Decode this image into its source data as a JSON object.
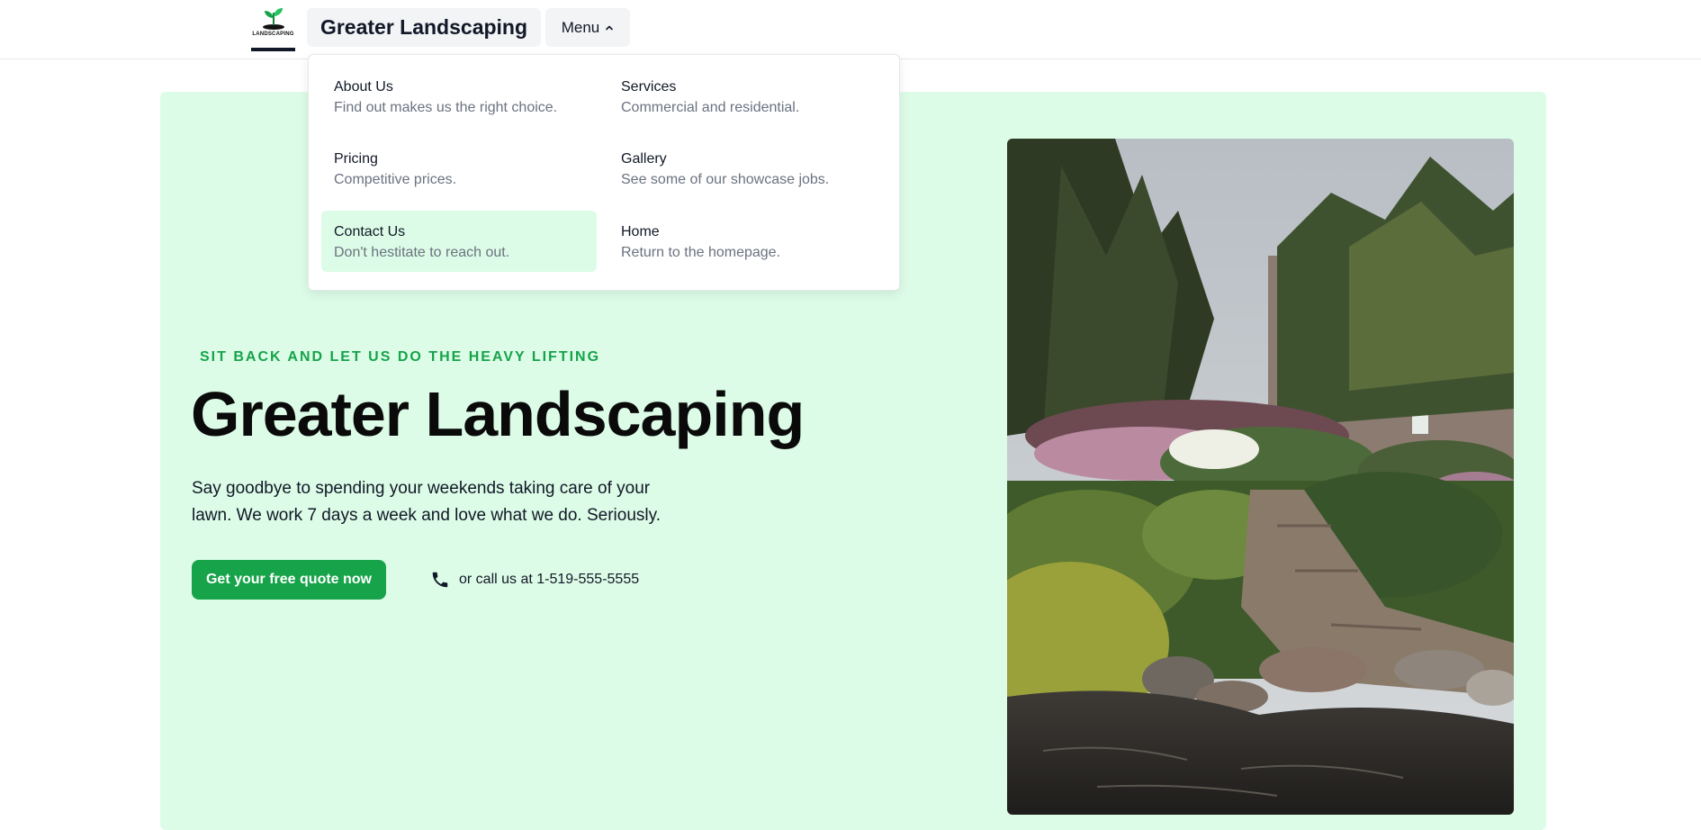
{
  "header": {
    "logo_text": "LANDSCAPING",
    "brand": "Greater Landscaping",
    "menu_label": "Menu"
  },
  "menu": {
    "items": [
      {
        "title": "About Us",
        "desc": "Find out makes us the right choice."
      },
      {
        "title": "Services",
        "desc": "Commercial and residential."
      },
      {
        "title": "Pricing",
        "desc": "Competitive prices."
      },
      {
        "title": "Gallery",
        "desc": "See some of our showcase jobs."
      },
      {
        "title": "Contact Us",
        "desc": "Don't hestitate to reach out.",
        "active": true
      },
      {
        "title": "Home",
        "desc": "Return to the homepage."
      }
    ]
  },
  "hero": {
    "tagline": "SIT BACK AND LET US DO THE HEAVY LIFTING",
    "title": "Greater Landscaping",
    "description": "Say goodbye to spending your weekends taking care of your lawn. We work 7 days a week and love what we do. Seriously.",
    "cta": "Get your free quote now",
    "call_text": "or call us at 1-519-555-5555",
    "image_icon": "garden-photo"
  },
  "colors": {
    "accent": "#16a34a",
    "hero_bg": "#dcfce7",
    "text": "#111827",
    "muted": "#6b7280"
  }
}
